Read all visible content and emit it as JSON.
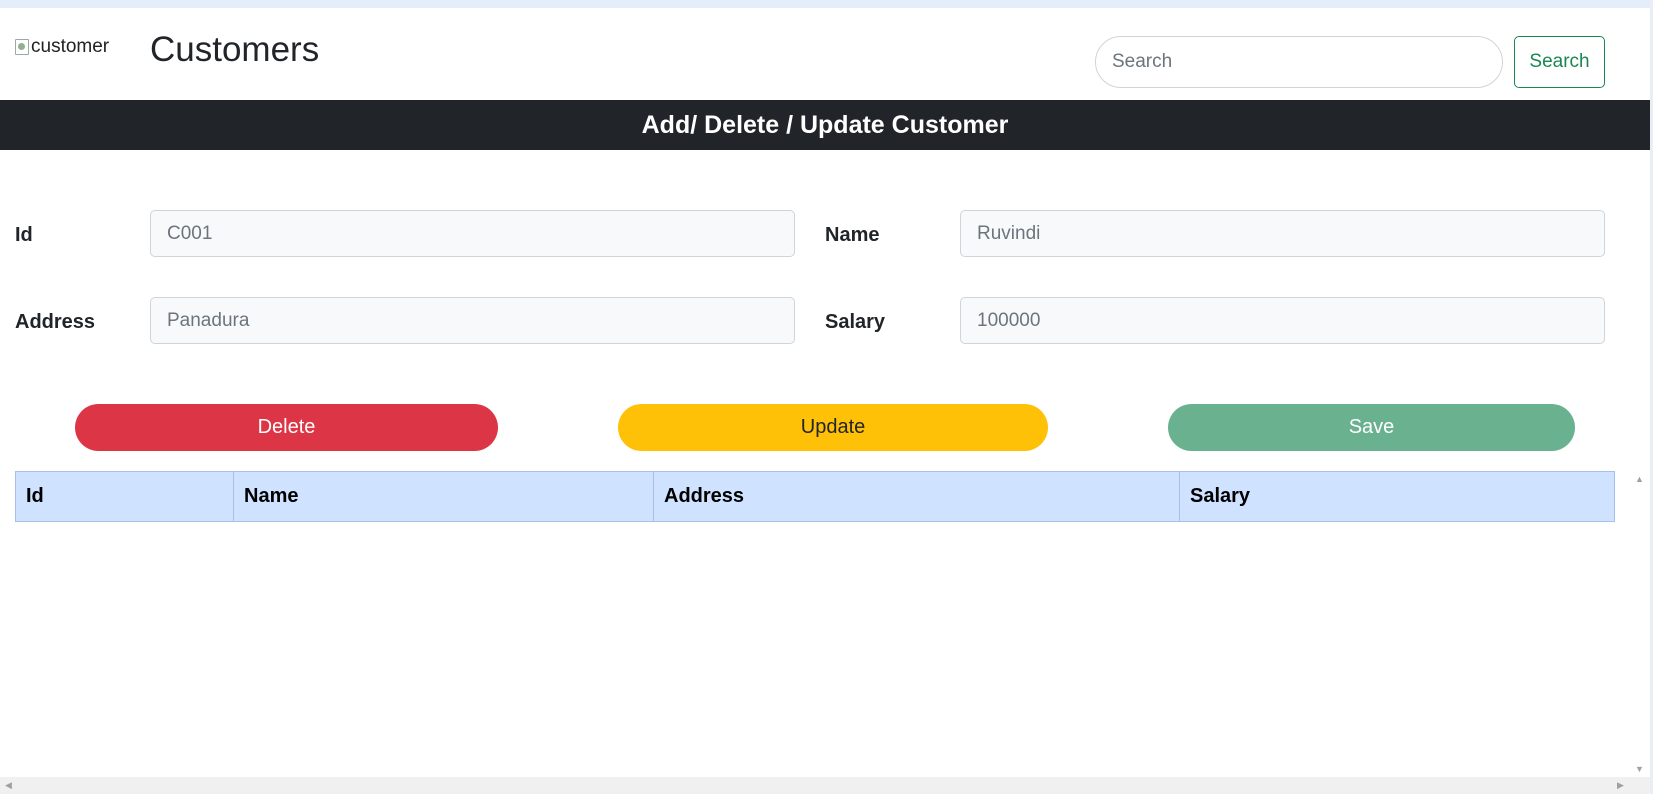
{
  "header": {
    "logo_alt": "customer",
    "title": "Customers",
    "search_placeholder": "Search",
    "search_button": "Search"
  },
  "section": {
    "title": "Add/ Delete / Update Customer"
  },
  "form": {
    "id": {
      "label": "Id",
      "value": "C001"
    },
    "name": {
      "label": "Name",
      "value": "Ruvindi"
    },
    "address": {
      "label": "Address",
      "value": "Panadura"
    },
    "salary": {
      "label": "Salary",
      "value": "100000"
    }
  },
  "actions": {
    "delete": "Delete",
    "update": "Update",
    "save": "Save"
  },
  "table": {
    "columns": [
      "Id",
      "Name",
      "Address",
      "Salary"
    ],
    "rows": []
  },
  "colors": {
    "header_bar": "#212529",
    "delete": "#dc3545",
    "update": "#ffc107",
    "save": "#6ab18f",
    "search_outline": "#198754",
    "table_header": "#cfe2ff"
  },
  "icons": {
    "scroll_up": "▲",
    "scroll_down": "▼",
    "scroll_left": "◀",
    "scroll_right": "▶"
  }
}
